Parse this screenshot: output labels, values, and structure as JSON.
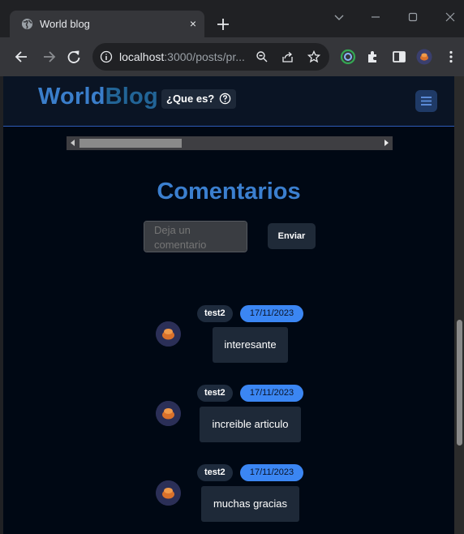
{
  "browser": {
    "tab_title": "World blog",
    "tab_close": "×",
    "url_host": "localhost",
    "url_rest": ":3000/posts/pr..."
  },
  "site": {
    "logo_world": "World",
    "logo_blog": "Blog",
    "que_es": "¿Que es?"
  },
  "comments": {
    "title": "Comentarios",
    "placeholder": "Deja un comentario",
    "send_label": "Enviar",
    "items": [
      {
        "user": "test2",
        "date": "17/11/2023",
        "text": "interesante"
      },
      {
        "user": "test2",
        "date": "17/11/2023",
        "text": "increible articulo"
      },
      {
        "user": "test2",
        "date": "17/11/2023",
        "text": "muchas gracias"
      }
    ]
  },
  "colors": {
    "accent": "#3b7fcf",
    "date_badge": "#3b86f3",
    "page_bg": "#000814"
  }
}
